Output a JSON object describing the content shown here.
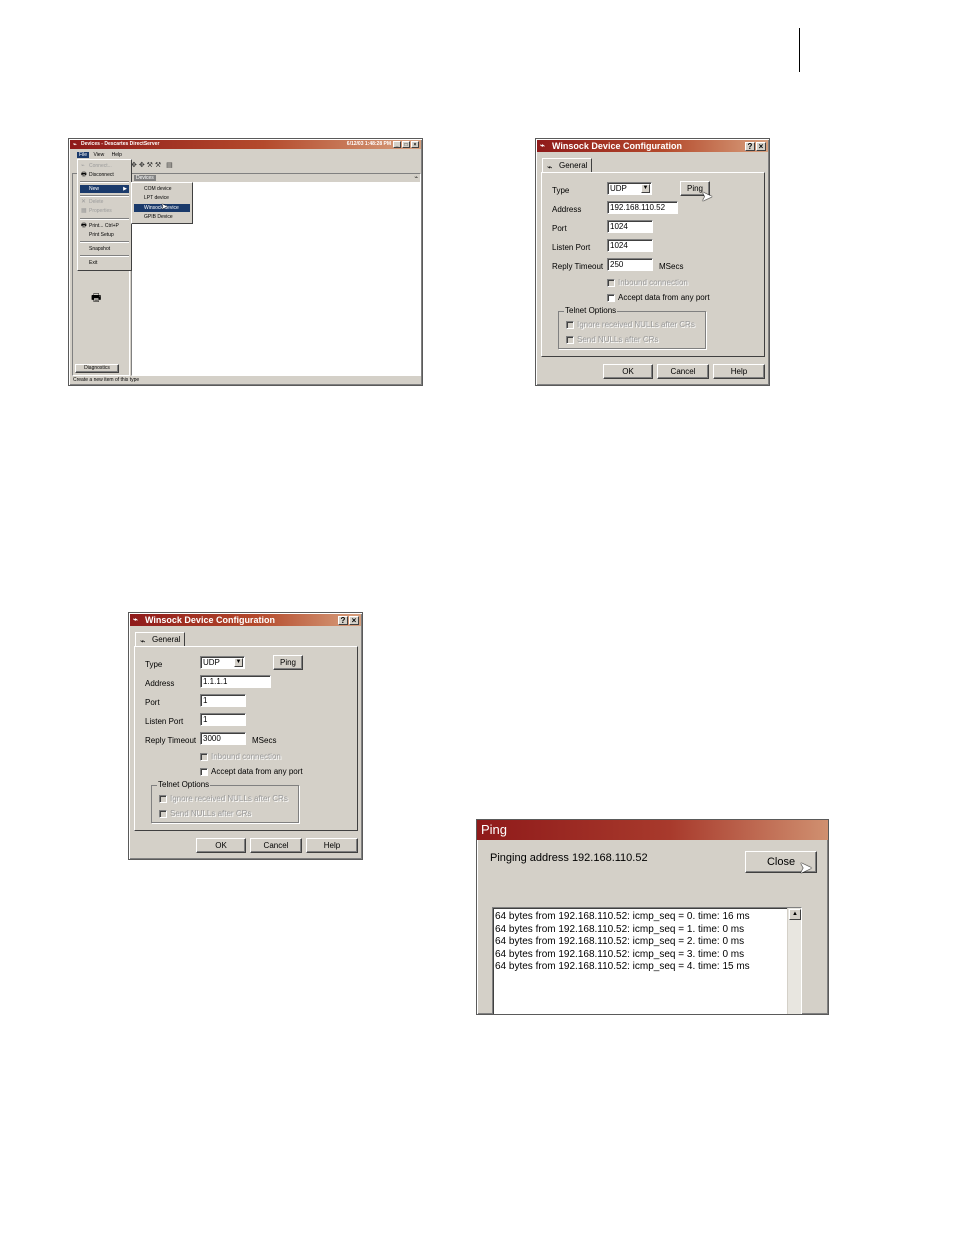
{
  "devices_window": {
    "title": "Devices - Descartes DirectServer",
    "datetime": "6/12/03 1:48:28 PM",
    "menubar": [
      "File",
      "View",
      "Help"
    ],
    "file_menu": [
      {
        "label": "Connect...",
        "enabled": false
      },
      {
        "label": "Disconnect",
        "enabled": true
      },
      {
        "label": "New",
        "enabled": true,
        "submenu": true
      },
      {
        "label": "Delete",
        "enabled": false
      },
      {
        "label": "Properties",
        "enabled": false
      },
      {
        "label": "Print...  Ctrl+P",
        "enabled": true
      },
      {
        "label": "Print Setup",
        "enabled": true
      },
      {
        "label": "Snapshot",
        "enabled": true
      },
      {
        "label": "Exit",
        "enabled": true
      }
    ],
    "new_submenu": [
      "COM device",
      "LPT device",
      "Winsock device",
      "GPIB Device"
    ],
    "selected_submenu_item": "Winsock device",
    "content_header": "Devices",
    "sidebar_button": "Diagnostics",
    "status": "Create a new item of this type"
  },
  "config_dialog_1": {
    "title": "Winsock Device Configuration",
    "tab": "General",
    "type_label": "Type",
    "type_value": "UDP",
    "ping_button": "Ping",
    "address_label": "Address",
    "address_value": "192.168.110.52",
    "port_label": "Port",
    "port_value": "1024",
    "listen_port_label": "Listen Port",
    "listen_port_value": "1024",
    "reply_timeout_label": "Reply Timeout",
    "reply_timeout_value": "250",
    "msecs": "MSecs",
    "inbound": "Inbound connection",
    "accept_any": "Accept data from any port",
    "telnet_group": "Telnet Options",
    "telnet_ignore": "Ignore received NULLs after CRs",
    "telnet_send": "Send NULLs after CRs",
    "ok": "OK",
    "cancel": "Cancel",
    "help": "Help"
  },
  "config_dialog_2": {
    "title": "Winsock Device Configuration",
    "tab": "General",
    "type_label": "Type",
    "type_value": "UDP",
    "ping_button": "Ping",
    "address_label": "Address",
    "address_value": "1.1.1.1",
    "port_label": "Port",
    "port_value": "1",
    "listen_port_label": "Listen Port",
    "listen_port_value": "1",
    "reply_timeout_label": "Reply Timeout",
    "reply_timeout_value": "3000",
    "msecs": "MSecs",
    "inbound": "Inbound connection",
    "accept_any": "Accept data from any port",
    "telnet_group": "Telnet Options",
    "telnet_ignore": "Ignore received NULLs after CRs",
    "telnet_send": "Send NULLs after CRs",
    "ok": "OK",
    "cancel": "Cancel",
    "help": "Help"
  },
  "ping_dialog": {
    "title": "Ping",
    "status": "Pinging address 192.168.110.52",
    "close": "Close",
    "lines": [
      "64 bytes from 192.168.110.52:  icmp_seq = 0.  time: 16 ms",
      "64 bytes from 192.168.110.52:  icmp_seq = 1.  time: 0 ms",
      "64 bytes from 192.168.110.52:  icmp_seq = 2.  time: 0 ms",
      "64 bytes from 192.168.110.52:  icmp_seq = 3.  time: 0 ms",
      "64 bytes from 192.168.110.52:  icmp_seq = 4.  time: 15 ms"
    ]
  },
  "colors": {
    "title_red": "#8f1a1a",
    "face": "#d4d0c8",
    "menu_highlight": "#1a3a6b"
  }
}
